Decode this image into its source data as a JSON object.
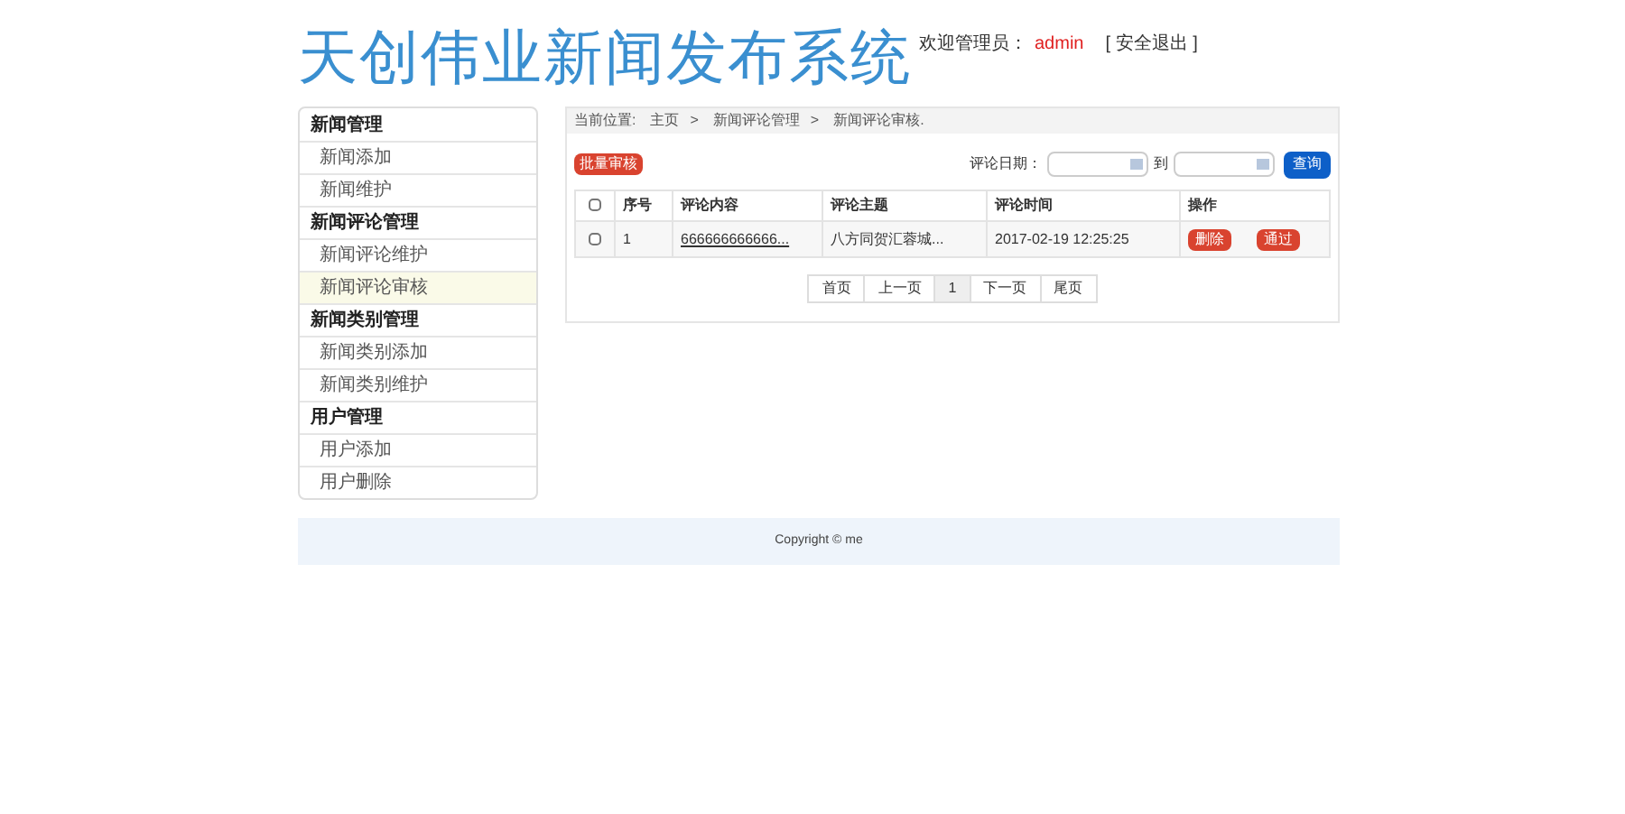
{
  "header": {
    "title": "天创伟业新闻发布系统",
    "welcome_label": "欢迎管理员：",
    "user": "admin",
    "logout": "[ 安全退出 ]"
  },
  "sidebar": [
    {
      "title": "新闻管理",
      "items": [
        {
          "label": "新闻添加",
          "selected": false
        },
        {
          "label": "新闻维护",
          "selected": false
        }
      ]
    },
    {
      "title": "新闻评论管理",
      "items": [
        {
          "label": "新闻评论维护",
          "selected": false
        },
        {
          "label": "新闻评论审核",
          "selected": true
        }
      ]
    },
    {
      "title": "新闻类别管理",
      "items": [
        {
          "label": "新闻类别添加",
          "selected": false
        },
        {
          "label": "新闻类别维护",
          "selected": false
        }
      ]
    },
    {
      "title": "用户管理",
      "items": [
        {
          "label": "用户添加",
          "selected": false
        },
        {
          "label": "用户删除",
          "selected": false
        }
      ]
    }
  ],
  "breadcrumb": {
    "label": "当前位置:",
    "items": [
      "主页",
      "新闻评论管理",
      "新闻评论审核."
    ],
    "separator": ">"
  },
  "toolbar": {
    "batch_button": "批量审核",
    "date_label": "评论日期：",
    "to_label": "到",
    "search_button": "查询"
  },
  "table": {
    "select_all_checked": false,
    "columns": [
      "序号",
      "评论内容",
      "评论主题",
      "评论时间",
      "操作"
    ],
    "rows": [
      {
        "checked": false,
        "cells": [
          "1",
          "666666666666...",
          "八方同贺汇蓉城...",
          "2017-02-19 12:25:25"
        ],
        "actions": [
          "删除",
          "通过"
        ]
      }
    ]
  },
  "pagination": [
    {
      "label": "首页",
      "selected": false
    },
    {
      "label": "上一页",
      "selected": false
    },
    {
      "label": "1",
      "selected": true
    },
    {
      "label": "下一页",
      "selected": false
    },
    {
      "label": "尾页",
      "selected": false
    }
  ],
  "footer": {
    "copyright": "Copyright © me"
  }
}
